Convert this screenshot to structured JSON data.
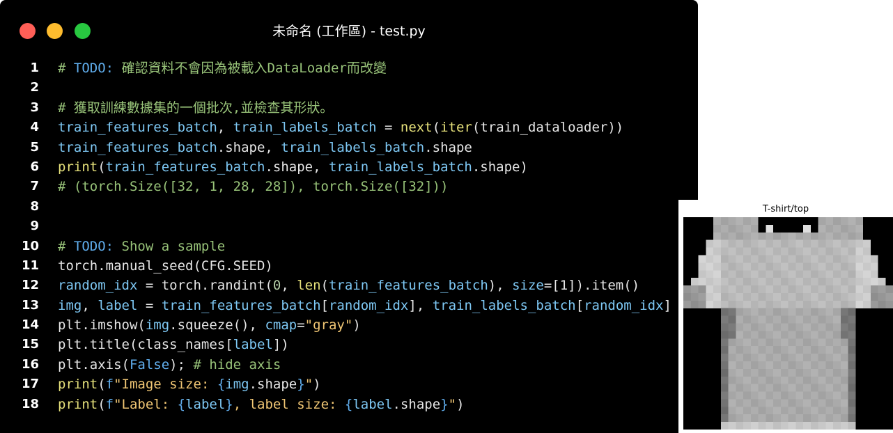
{
  "window": {
    "title": "未命名 (工作區) - test.py",
    "traffic_lights": [
      "close",
      "minimize",
      "maximize"
    ],
    "colors": {
      "close": "#ff5f57",
      "minimize": "#febc2e",
      "maximize": "#28c840"
    }
  },
  "editor": {
    "lines": [
      {
        "num": "1",
        "tokens": [
          {
            "t": "# ",
            "k": "comment"
          },
          {
            "t": "TODO:",
            "k": "kw"
          },
          {
            "t": " 確認資料不會因為被載入DataLoader而改變",
            "k": "comment"
          }
        ]
      },
      {
        "num": "2",
        "tokens": []
      },
      {
        "num": "3",
        "tokens": [
          {
            "t": "# 獲取訓練數據集的一個批次,並檢查其形狀。",
            "k": "comment"
          }
        ]
      },
      {
        "num": "4",
        "tokens": [
          {
            "t": "train_features_batch",
            "k": "var"
          },
          {
            "t": ", ",
            "k": "plain"
          },
          {
            "t": "train_labels_batch",
            "k": "var"
          },
          {
            "t": " = ",
            "k": "plain"
          },
          {
            "t": "next",
            "k": "fn"
          },
          {
            "t": "(",
            "k": "plain"
          },
          {
            "t": "iter",
            "k": "fn"
          },
          {
            "t": "(train_dataloader))",
            "k": "plain"
          }
        ]
      },
      {
        "num": "5",
        "tokens": [
          {
            "t": "train_features_batch",
            "k": "var"
          },
          {
            "t": ".shape, ",
            "k": "plain"
          },
          {
            "t": "train_labels_batch",
            "k": "var"
          },
          {
            "t": ".shape",
            "k": "plain"
          }
        ]
      },
      {
        "num": "6",
        "tokens": [
          {
            "t": "print",
            "k": "fn"
          },
          {
            "t": "(",
            "k": "plain"
          },
          {
            "t": "train_features_batch",
            "k": "var"
          },
          {
            "t": ".shape, ",
            "k": "plain"
          },
          {
            "t": "train_labels_batch",
            "k": "var"
          },
          {
            "t": ".shape)",
            "k": "plain"
          }
        ]
      },
      {
        "num": "7",
        "tokens": [
          {
            "t": "# (torch.Size([32, 1, 28, 28]), torch.Size([32]))",
            "k": "comment"
          }
        ]
      },
      {
        "num": "8",
        "tokens": []
      },
      {
        "num": "9",
        "tokens": []
      },
      {
        "num": "10",
        "tokens": [
          {
            "t": "# ",
            "k": "comment"
          },
          {
            "t": "TODO:",
            "k": "kw"
          },
          {
            "t": " Show a sample",
            "k": "comment"
          }
        ]
      },
      {
        "num": "11",
        "tokens": [
          {
            "t": "torch.manual_seed(CFG.SEED)",
            "k": "plain"
          }
        ]
      },
      {
        "num": "12",
        "tokens": [
          {
            "t": "random_idx",
            "k": "var"
          },
          {
            "t": " = torch.randint(",
            "k": "plain"
          },
          {
            "t": "0",
            "k": "num"
          },
          {
            "t": ", ",
            "k": "plain"
          },
          {
            "t": "len",
            "k": "fn"
          },
          {
            "t": "(",
            "k": "plain"
          },
          {
            "t": "train_features_batch",
            "k": "var"
          },
          {
            "t": "), ",
            "k": "plain"
          },
          {
            "t": "size",
            "k": "var"
          },
          {
            "t": "=[1]).item()",
            "k": "plain"
          }
        ]
      },
      {
        "num": "13",
        "tokens": [
          {
            "t": "img",
            "k": "var"
          },
          {
            "t": ", ",
            "k": "plain"
          },
          {
            "t": "label",
            "k": "var"
          },
          {
            "t": " = ",
            "k": "plain"
          },
          {
            "t": "train_features_batch",
            "k": "var"
          },
          {
            "t": "[",
            "k": "plain"
          },
          {
            "t": "random_idx",
            "k": "var"
          },
          {
            "t": "], ",
            "k": "plain"
          },
          {
            "t": "train_labels_batch",
            "k": "var"
          },
          {
            "t": "[",
            "k": "plain"
          },
          {
            "t": "random_idx",
            "k": "var"
          },
          {
            "t": "]",
            "k": "plain"
          }
        ]
      },
      {
        "num": "14",
        "tokens": [
          {
            "t": "plt.imshow(",
            "k": "plain"
          },
          {
            "t": "img",
            "k": "var"
          },
          {
            "t": ".squeeze(), ",
            "k": "plain"
          },
          {
            "t": "cmap",
            "k": "var"
          },
          {
            "t": "=",
            "k": "plain"
          },
          {
            "t": "\"gray\"",
            "k": "str"
          },
          {
            "t": ")",
            "k": "plain"
          }
        ]
      },
      {
        "num": "15",
        "tokens": [
          {
            "t": "plt.title(class_names[",
            "k": "plain"
          },
          {
            "t": "label",
            "k": "var"
          },
          {
            "t": "])",
            "k": "plain"
          }
        ]
      },
      {
        "num": "16",
        "tokens": [
          {
            "t": "plt.axis(",
            "k": "plain"
          },
          {
            "t": "False",
            "k": "kw"
          },
          {
            "t": "); ",
            "k": "plain"
          },
          {
            "t": "# hide axis",
            "k": "comment"
          }
        ]
      },
      {
        "num": "17",
        "tokens": [
          {
            "t": "print",
            "k": "fn"
          },
          {
            "t": "(",
            "k": "plain"
          },
          {
            "t": "f",
            "k": "kw"
          },
          {
            "t": "\"Image size: ",
            "k": "str"
          },
          {
            "t": "{",
            "k": "kw"
          },
          {
            "t": "img",
            "k": "var"
          },
          {
            "t": ".shape",
            "k": "plain"
          },
          {
            "t": "}",
            "k": "kw"
          },
          {
            "t": "\"",
            "k": "str"
          },
          {
            "t": ")",
            "k": "plain"
          }
        ]
      },
      {
        "num": "18",
        "tokens": [
          {
            "t": "print",
            "k": "fn"
          },
          {
            "t": "(",
            "k": "plain"
          },
          {
            "t": "f",
            "k": "kw"
          },
          {
            "t": "\"Label: ",
            "k": "str"
          },
          {
            "t": "{",
            "k": "kw"
          },
          {
            "t": "label",
            "k": "var"
          },
          {
            "t": "}",
            "k": "kw"
          },
          {
            "t": ", label size: ",
            "k": "str"
          },
          {
            "t": "{",
            "k": "kw"
          },
          {
            "t": "label",
            "k": "var"
          },
          {
            "t": ".shape",
            "k": "plain"
          },
          {
            "t": "}",
            "k": "kw"
          },
          {
            "t": "\"",
            "k": "str"
          },
          {
            "t": ")",
            "k": "plain"
          }
        ]
      }
    ]
  },
  "figure": {
    "title": "T-shirt/top",
    "image_kind": "grayscale-tshirt-pixel-image"
  }
}
